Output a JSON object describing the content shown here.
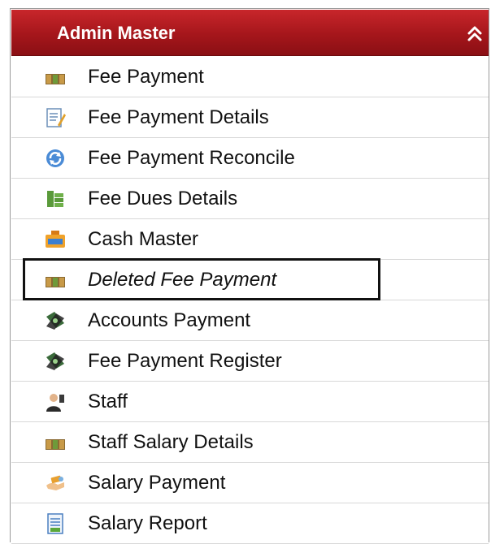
{
  "menu": {
    "title": "Admin Master",
    "collapse_icon": "double-chevron-up-icon",
    "items": [
      {
        "label": "Fee Payment",
        "icon": "money-stack-icon"
      },
      {
        "label": "Fee Payment Details",
        "icon": "document-edit-icon"
      },
      {
        "label": "Fee Payment Reconcile",
        "icon": "refresh-icon"
      },
      {
        "label": "Fee Dues Details",
        "icon": "cash-pile-icon"
      },
      {
        "label": "Cash Master",
        "icon": "cash-register-icon"
      },
      {
        "label": "Deleted Fee Payment",
        "icon": "money-stack-icon"
      },
      {
        "label": "Accounts Payment",
        "icon": "currency-swap-icon"
      },
      {
        "label": "Fee Payment Register",
        "icon": "currency-swap-icon"
      },
      {
        "label": "Staff",
        "icon": "staff-person-icon"
      },
      {
        "label": "Staff Salary Details",
        "icon": "money-stack-icon"
      },
      {
        "label": "Salary Payment",
        "icon": "hand-money-icon"
      },
      {
        "label": "Salary Report",
        "icon": "report-document-icon"
      }
    ]
  },
  "colors": {
    "header_bg": "#a5161b",
    "header_text": "#ffffff",
    "highlight_border": "#111111"
  }
}
